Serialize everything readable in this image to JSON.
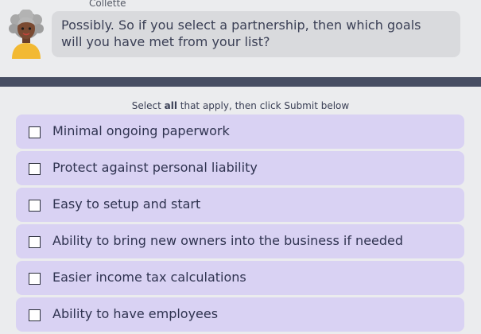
{
  "speaker": {
    "name": "Collette",
    "avatar_icon": "woman-avatar-icon"
  },
  "message": {
    "line1": "Possibly. So if you select a partnership, then which goals",
    "line2": "will you have met from your list?"
  },
  "instruction": {
    "before": "Select ",
    "emphasis": "all",
    "after": " that apply, then click Submit below"
  },
  "options": [
    {
      "label": "Minimal ongoing paperwork",
      "checked": false
    },
    {
      "label": "Protect against personal liability",
      "checked": false
    },
    {
      "label": "Easy to setup and start",
      "checked": false
    },
    {
      "label": "Ability to bring new owners into the business if needed",
      "checked": false
    },
    {
      "label": "Easier income tax calculations",
      "checked": false
    },
    {
      "label": "Ability to have employees",
      "checked": false
    }
  ],
  "colors": {
    "background": "#ebecee",
    "bubble": "#d9dadd",
    "divider": "#474e63",
    "option_bg": "#d9d2f3",
    "text": "#2f3350"
  }
}
